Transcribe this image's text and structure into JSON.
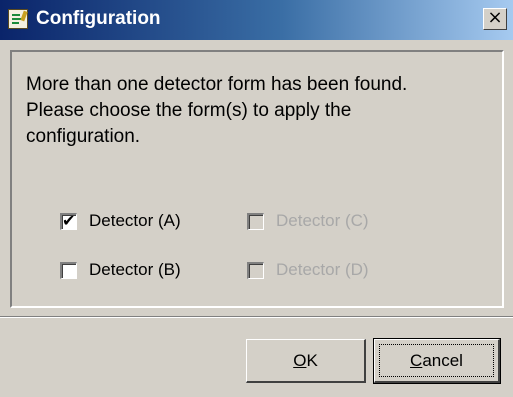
{
  "window": {
    "title": "Configuration",
    "close_label": "×",
    "icon": "config-app-icon"
  },
  "message": {
    "line1": "More than one detector form has been found.",
    "line2": "Please choose the form(s) to apply the",
    "line3": "configuration."
  },
  "checkboxes": [
    {
      "label": "Detector (A)",
      "checked": true,
      "enabled": true
    },
    {
      "label": "Detector (B)",
      "checked": false,
      "enabled": true
    },
    {
      "label": "Detector (C)",
      "checked": false,
      "enabled": false
    },
    {
      "label": "Detector (D)",
      "checked": false,
      "enabled": false
    }
  ],
  "buttons": {
    "ok": {
      "accel": "O",
      "rest": "K"
    },
    "cancel": {
      "accel": "C",
      "rest": "ancel"
    }
  },
  "check_glyph": "✔"
}
